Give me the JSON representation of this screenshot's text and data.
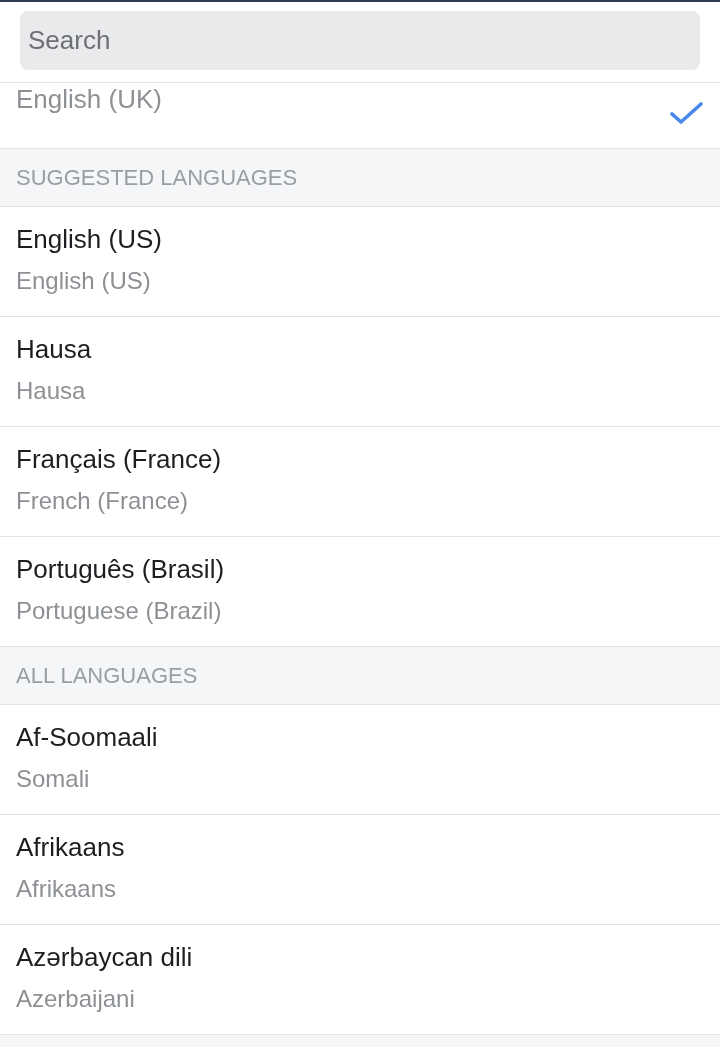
{
  "search": {
    "placeholder": "Search"
  },
  "current_language": {
    "name": "English (UK)",
    "selected": true
  },
  "sections": [
    {
      "heading": "SUGGESTED LANGUAGES",
      "items": [
        {
          "name": "English (US)",
          "english_name": "English (US)",
          "selected": false
        },
        {
          "name": "Hausa",
          "english_name": "Hausa",
          "selected": false
        },
        {
          "name": "Français (France)",
          "english_name": "French (France)",
          "selected": false
        },
        {
          "name": "Português (Brasil)",
          "english_name": "Portuguese (Brazil)",
          "selected": false
        }
      ]
    },
    {
      "heading": "ALL LANGUAGES",
      "items": [
        {
          "name": "Af-Soomaali",
          "english_name": "Somali",
          "selected": false
        },
        {
          "name": "Afrikaans",
          "english_name": "Afrikaans",
          "selected": false
        },
        {
          "name": "Azərbaycan dili",
          "english_name": "Azerbaijani",
          "selected": false
        }
      ]
    }
  ]
}
